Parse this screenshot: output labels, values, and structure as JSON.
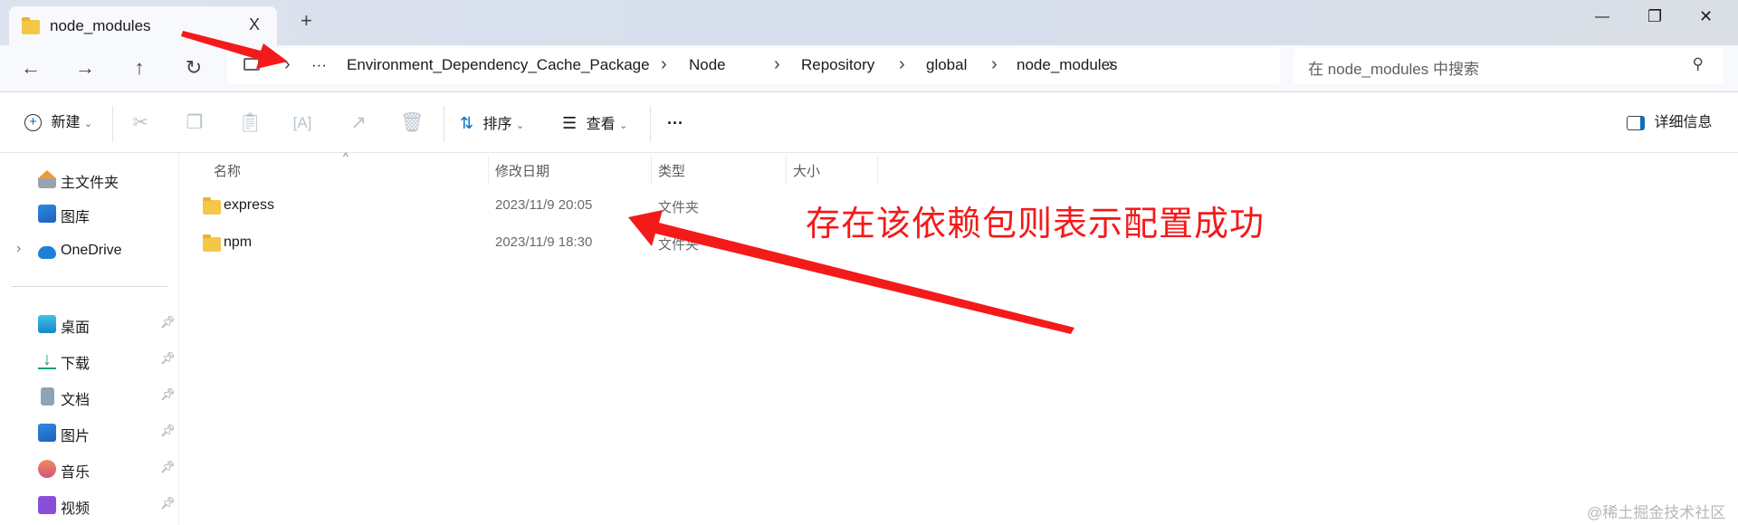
{
  "window": {
    "tab_title": "node_modules",
    "tab_close": "X",
    "new_tab": "+",
    "minimize": "—",
    "restore": "❐",
    "close": "✕"
  },
  "nav": {
    "back": "←",
    "forward": "→",
    "up": "↑",
    "refresh": "↻"
  },
  "address": {
    "overflow": "···",
    "crumbs": [
      "Environment_Dependency_Cache_Package",
      "Node",
      "Repository",
      "global",
      "node_modules"
    ],
    "separator": "›"
  },
  "search": {
    "placeholder": "在 node_modules 中搜索"
  },
  "toolbar": {
    "new_label": "新建",
    "sort_label": "排序",
    "view_label": "查看",
    "more": "···",
    "details_label": "详细信息",
    "chevron": "⌄"
  },
  "sidebar": {
    "top": [
      {
        "label": "主文件夹"
      },
      {
        "label": "图库"
      },
      {
        "label": "OneDrive"
      }
    ],
    "pinned": [
      {
        "label": "桌面"
      },
      {
        "label": "下载"
      },
      {
        "label": "文档"
      },
      {
        "label": "图片"
      },
      {
        "label": "音乐"
      },
      {
        "label": "视频"
      }
    ]
  },
  "columns": {
    "name": "名称",
    "date": "修改日期",
    "type": "类型",
    "size": "大小"
  },
  "files": [
    {
      "name": "express",
      "date": "2023/11/9 20:05",
      "type": "文件夹"
    },
    {
      "name": "npm",
      "date": "2023/11/9 18:30",
      "type": "文件夹"
    }
  ],
  "annotation": {
    "text": "存在该依赖包则表示配置成功",
    "color": "#f41a1a"
  },
  "watermark": "@稀土掘金技术社区"
}
